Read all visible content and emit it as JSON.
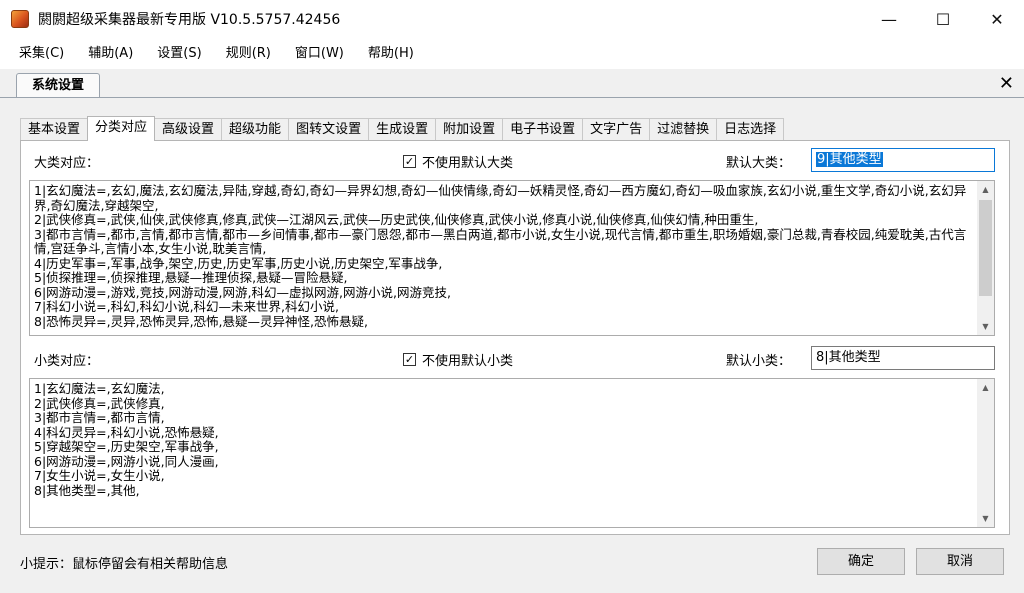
{
  "window": {
    "title": "閼閼超级采集器最新专用版 V10.5.5757.42456",
    "minimize": "—",
    "maximize": "☐",
    "close": "✕"
  },
  "menu": [
    "采集(C)",
    "辅助(A)",
    "设置(S)",
    "规则(R)",
    "窗口(W)",
    "帮助(H)"
  ],
  "doc_tab": {
    "label": "系统设置",
    "close": "✕"
  },
  "tabs": [
    "基本设置",
    "分类对应",
    "高级设置",
    "超级功能",
    "图转文设置",
    "生成设置",
    "附加设置",
    "电子书设置",
    "文字广告",
    "过滤替换",
    "日志选择"
  ],
  "active_tab": "分类对应",
  "big_category": {
    "label": "大类对应：",
    "checkbox_label": "不使用默认大类",
    "checked": true,
    "default_label": "默认大类：",
    "default_prefix": "9",
    "default_value": "其他类型",
    "text": "1|玄幻魔法=,玄幻,魔法,玄幻魔法,异陆,穿越,奇幻,奇幻—异界幻想,奇幻—仙侠情缘,奇幻—妖精灵怪,奇幻—西方魔幻,奇幻—吸血家族,玄幻小说,重生文学,奇幻小说,玄幻异界,奇幻魔法,穿越架空,\n2|武侠修真=,武侠,仙侠,武侠修真,修真,武侠—江湖风云,武侠—历史武侠,仙侠修真,武侠小说,修真小说,仙侠修真,仙侠幻情,种田重生,\n3|都市言情=,都市,言情,都市言情,都市—乡间情事,都市—豪门恩怨,都市—黑白两道,都市小说,女生小说,现代言情,都市重生,职场婚姻,豪门总裁,青春校园,纯爱耽美,古代言情,宫廷争斗,言情小本,女生小说,耽美言情,\n4|历史军事=,军事,战争,架空,历史,历史军事,历史小说,历史架空,军事战争,\n5|侦探推理=,侦探推理,悬疑—推理侦探,悬疑—冒险悬疑,\n6|网游动漫=,游戏,竞技,网游动漫,网游,科幻—虚拟网游,网游小说,网游竞技,\n7|科幻小说=,科幻,科幻小说,科幻—未来世界,科幻小说,\n8|恐怖灵异=,灵异,恐怖灵异,恐怖,悬疑—灵异神怪,恐怖悬疑,"
  },
  "small_category": {
    "label": "小类对应：",
    "checkbox_label": "不使用默认小类",
    "checked": true,
    "default_label": "默认小类：",
    "default_prefix": "8",
    "default_value": "其他类型",
    "text": "1|玄幻魔法=,玄幻魔法,\n2|武侠修真=,武侠修真,\n3|都市言情=,都市言情,\n4|科幻灵异=,科幻小说,恐怖悬疑,\n5|穿越架空=,历史架空,军事战争,\n6|网游动漫=,网游小说,同人漫画,\n7|女生小说=,女生小说,\n8|其他类型=,其他,"
  },
  "tip": "小提示：鼠标停留会有相关帮助信息",
  "buttons": {
    "ok": "确定",
    "cancel": "取消"
  },
  "icons": {
    "app": "app-icon",
    "scroll_up": "chevron-up-icon",
    "scroll_down": "chevron-down-icon"
  }
}
